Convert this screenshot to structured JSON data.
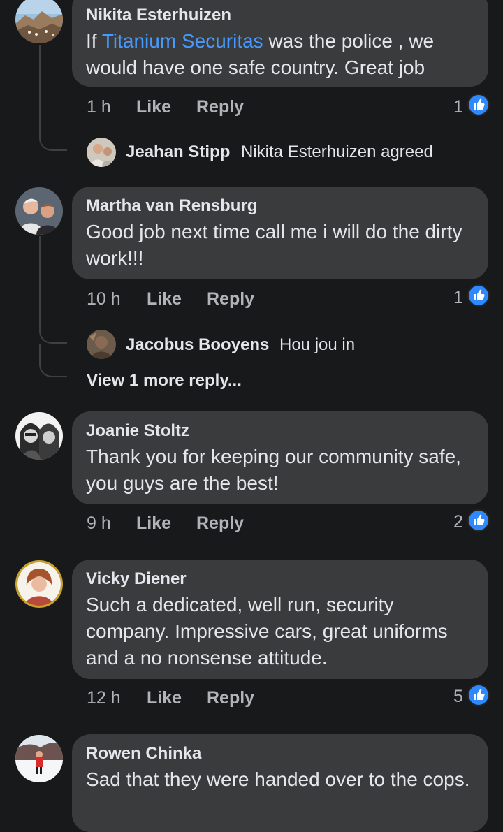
{
  "comments": [
    {
      "author": "Nikita Esterhuizen",
      "text_prefix": "If ",
      "mention": "Titanium Securitas",
      "text_suffix": " was the police , we would have one safe country. Great job",
      "time": "1 h",
      "like_label": "Like",
      "reply_label": "Reply",
      "reaction_count": "1",
      "reply_preview": {
        "name": "Jeahan Stipp",
        "text": "Nikita Esterhuizen agreed"
      }
    },
    {
      "author": "Martha van Rensburg",
      "text": "Good job next time call me i will do the dirty work!!!",
      "time": "10 h",
      "like_label": "Like",
      "reply_label": "Reply",
      "reaction_count": "1",
      "reply_preview": {
        "name": "Jacobus Booyens",
        "text": "Hou jou in"
      },
      "view_more": "View 1 more reply..."
    },
    {
      "author": "Joanie Stoltz",
      "text": "Thank you for keeping our community safe, you guys are the best!",
      "time": "9 h",
      "like_label": "Like",
      "reply_label": "Reply",
      "reaction_count": "2"
    },
    {
      "author": "Vicky Diener",
      "text": "Such a dedicated, well run, security company. Impressive cars, great uniforms and a no nonsense attitude.",
      "time": "12 h",
      "like_label": "Like",
      "reply_label": "Reply",
      "reaction_count": "5"
    },
    {
      "author": "Rowen Chinka",
      "text": "Sad that they were handed over to the cops."
    }
  ],
  "colors": {
    "background": "#18191a",
    "bubble": "#3a3b3c",
    "primary_text": "#e4e6eb",
    "secondary_text": "#b0b3b8",
    "mention": "#4599ff",
    "like_badge": "#2e89ff"
  },
  "icons": {
    "reaction": "thumbs-up-icon"
  }
}
